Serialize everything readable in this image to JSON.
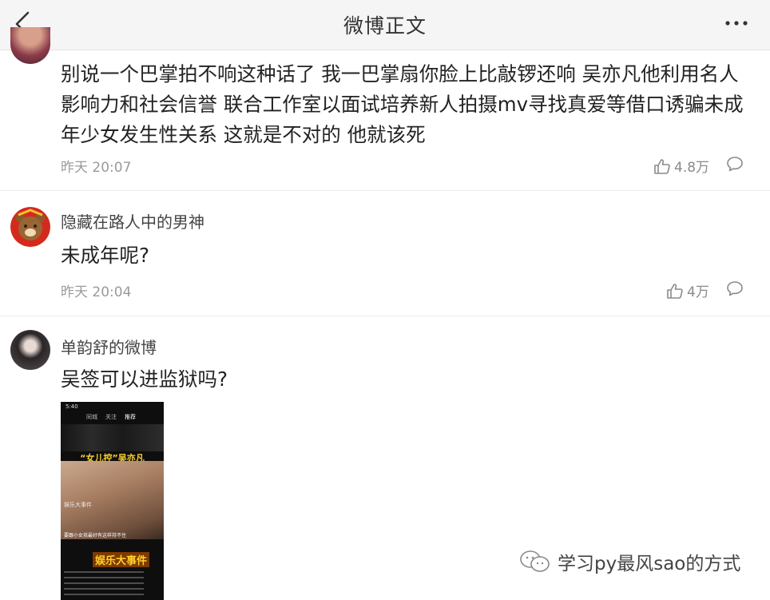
{
  "header": {
    "title": "微博正文",
    "back_icon": "chevron-left-icon",
    "more_icon": "more-dots-icon"
  },
  "comments": [
    {
      "username": "",
      "text": "别说一个巴掌拍不响这种话了 我一巴掌扇你脸上比敲锣还响 吴亦凡他利用名人影响力和社会信誉 联合工作室以面试培养新人拍摄mv寻找真爱等借口诱骗未成年少女发生性关系 这就是不对的 他就该死",
      "time": "昨天 20:07",
      "likes": "4.8万"
    },
    {
      "username": "隐藏在路人中的男神",
      "text": "未成年呢?",
      "time": "昨天 20:04",
      "likes": "4万"
    },
    {
      "username": "单韵舒的微博",
      "text": "吴签可以进监狱吗?",
      "image": {
        "status_time": "5:40",
        "tabs": [
          "同城",
          "关注",
          "推荐"
        ],
        "headline": "“女儿控”吴亦凡",
        "account": "娱乐大事件",
        "subtitle": "要跟小女孩最好有这样持不住",
        "badge": "娱乐大事件"
      }
    }
  ],
  "watermark": {
    "text": "学习py最风sao的方式",
    "icon": "wechat-icon"
  },
  "colors": {
    "header_bg": "#f5f5f5",
    "text": "#222222",
    "muted": "#9a9a9a",
    "divider": "#ececec"
  }
}
